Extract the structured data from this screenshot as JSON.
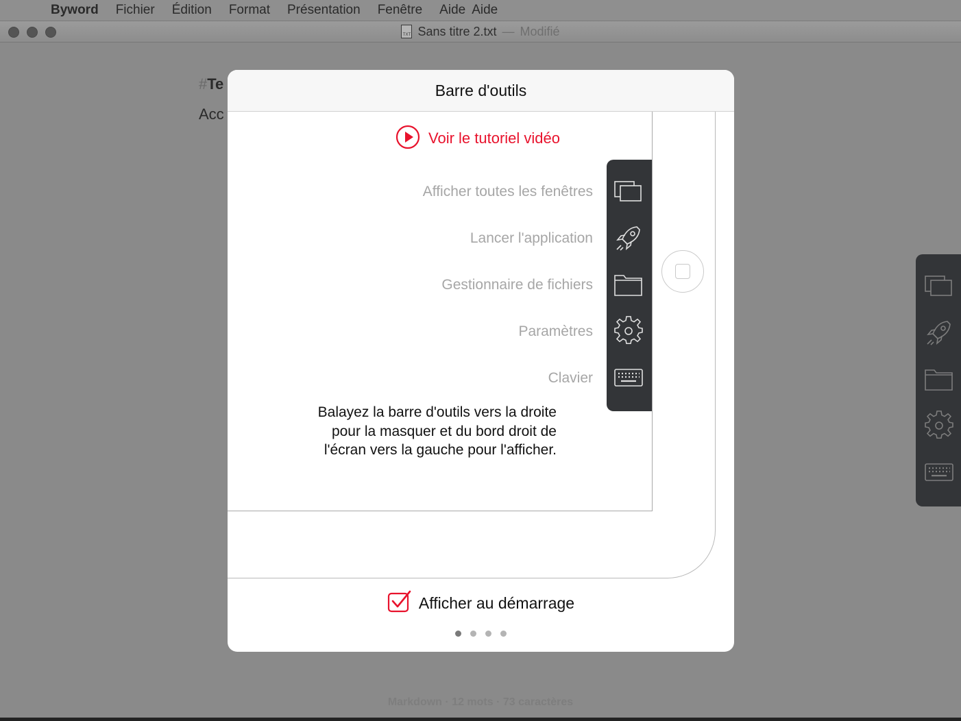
{
  "menubar": {
    "items": [
      "Byword",
      "Fichier",
      "Édition",
      "Format",
      "Présentation",
      "Fenêtre",
      "Aide",
      "Aide"
    ]
  },
  "window": {
    "file_icon_text": "TXT",
    "title": "Sans titre 2.txt",
    "separator": "—",
    "modified": "Modifié"
  },
  "editor": {
    "heading_hash": "#",
    "heading_text": "Te",
    "line_text": "Acc"
  },
  "statusbar": {
    "text": "Markdown · 12 mots · 73 caractères"
  },
  "modal": {
    "title": "Barre d'outils",
    "video_link": "Voir le tutoriel vidéo",
    "tools": [
      {
        "label": "Afficher toutes les fenêtres",
        "icon": "windows-icon"
      },
      {
        "label": "Lancer l'application",
        "icon": "rocket-icon"
      },
      {
        "label": "Gestionnaire de fichiers",
        "icon": "folder-icon"
      },
      {
        "label": "Paramètres",
        "icon": "gear-icon"
      },
      {
        "label": "Clavier",
        "icon": "keyboard-icon"
      }
    ],
    "help_text": "Balayez la barre d'outils vers la droite\npour la masquer et du bord droit de\nl'écran vers la gauche pour l'afficher.",
    "startup_checkbox": {
      "label": "Afficher au démarrage",
      "checked": true
    },
    "pagination": {
      "total": 4,
      "current": 1
    }
  },
  "colors": {
    "accent": "#e8122c",
    "toolbar_bg": "#333538",
    "dim_overlay": "#8a8a8a"
  }
}
